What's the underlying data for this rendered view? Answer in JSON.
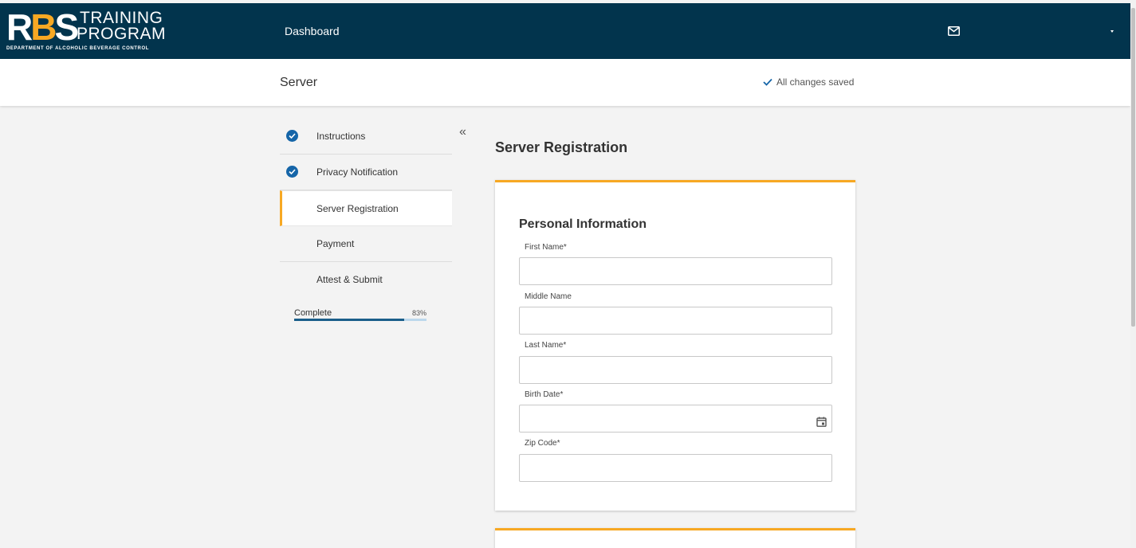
{
  "brand": {
    "letters": "RBS",
    "line1": "TRAINING",
    "line2": "PROGRAM",
    "department": "DEPARTMENT OF ALCOHOLIC BEVERAGE CONTROL",
    "accent_color": "#f7a823",
    "nav_color": "#02344d"
  },
  "nav": {
    "dashboard": "Dashboard",
    "mail_icon": "mail-icon",
    "menu_icon": "caret-down-icon"
  },
  "subheader": {
    "title": "Server",
    "saved_status": "All changes saved"
  },
  "steps": [
    {
      "label": "Instructions",
      "completed": true,
      "active": false
    },
    {
      "label": "Privacy Notification",
      "completed": true,
      "active": false
    },
    {
      "label": "Server Registration",
      "completed": false,
      "active": true
    },
    {
      "label": "Payment",
      "completed": false,
      "active": false
    },
    {
      "label": "Attest & Submit",
      "completed": false,
      "active": false
    }
  ],
  "progress": {
    "label": "Complete",
    "percent_text": "83%",
    "fraction": 0.83
  },
  "main": {
    "title": "Server Registration",
    "section_title": "Personal Information",
    "fields": [
      {
        "label": "First Name",
        "required": true,
        "value": ""
      },
      {
        "label": "Middle Name",
        "required": false,
        "value": ""
      },
      {
        "label": "Last Name",
        "required": true,
        "value": ""
      },
      {
        "label": "Birth Date",
        "required": true,
        "value": ""
      },
      {
        "label": "Zip Code",
        "required": true,
        "value": ""
      }
    ]
  }
}
